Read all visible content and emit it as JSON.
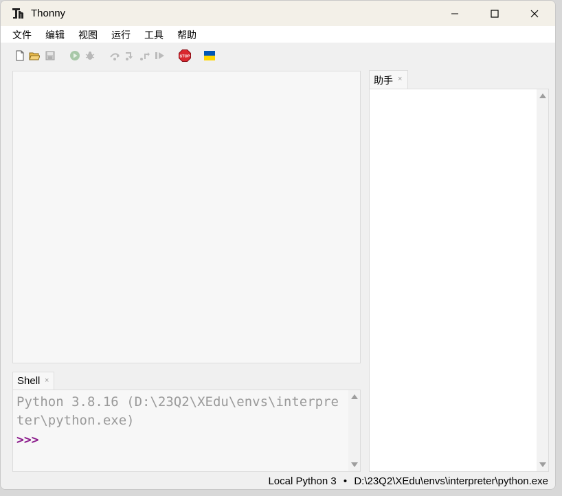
{
  "window": {
    "title": "Thonny"
  },
  "menu": [
    "文件",
    "编辑",
    "视图",
    "运行",
    "工具",
    "帮助"
  ],
  "toolbar": {
    "icons": [
      "new-file-icon",
      "open-file-icon",
      "save-icon",
      "run-icon",
      "debug-icon",
      "step-over-icon",
      "step-into-icon",
      "step-out-icon",
      "resume-icon",
      "stop-icon",
      "ukraine-flag-icon"
    ],
    "stop_label": "STOP",
    "colors": {
      "run": "#a8c8a8",
      "stop": "#d9282f",
      "flag_blue": "#0057b7",
      "flag_yellow": "#ffd700"
    }
  },
  "shell": {
    "tab_label": "Shell",
    "tab_close": "×",
    "banner": "Python 3.8.16 (D:\\23Q2\\XEdu\\envs\\interpreter\\python.exe)",
    "prompt": ">>>",
    "colors": {
      "banner": "#9a9a9a",
      "prompt": "#8b1a8b"
    }
  },
  "assistant": {
    "tab_label": "助手",
    "tab_close": "×"
  },
  "status": {
    "interpreter": "Local Python 3",
    "separator": "•",
    "path": "D:\\23Q2\\XEdu\\envs\\interpreter\\python.exe"
  }
}
